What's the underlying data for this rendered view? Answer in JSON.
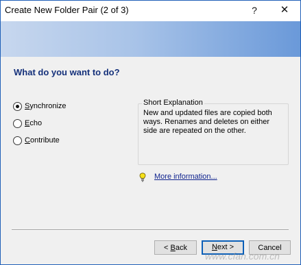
{
  "window": {
    "title": "Create New Folder Pair (2 of 3)",
    "help_glyph": "?",
    "close_glyph": "✕"
  },
  "heading": "What do you want to do?",
  "options": [
    {
      "first": "S",
      "rest": "ynchronize",
      "checked": true
    },
    {
      "first": "E",
      "rest": "cho",
      "checked": false
    },
    {
      "first": "C",
      "rest": "ontribute",
      "checked": false
    }
  ],
  "explanation": {
    "title": "Short Explanation",
    "text": "New and updated files are copied both ways. Renames and deletes on either side are repeated on the other."
  },
  "more_info": "More information...",
  "buttons": {
    "back_prefix": "< ",
    "back_ul": "B",
    "back_rest": "ack",
    "next_prefix": "",
    "next_ul": "N",
    "next_rest": "ext >",
    "cancel": "Cancel"
  },
  "watermark": "www.cfan.com.cn",
  "colors": {
    "heading": "#14307a",
    "banner_start": "#c7d7ee",
    "banner_end": "#6a99d9",
    "link": "#0b1f8c",
    "default_button_border": "#0b5fb8"
  },
  "icons": {
    "help": "question-icon",
    "close": "close-icon",
    "tip": "lightbulb-icon"
  }
}
